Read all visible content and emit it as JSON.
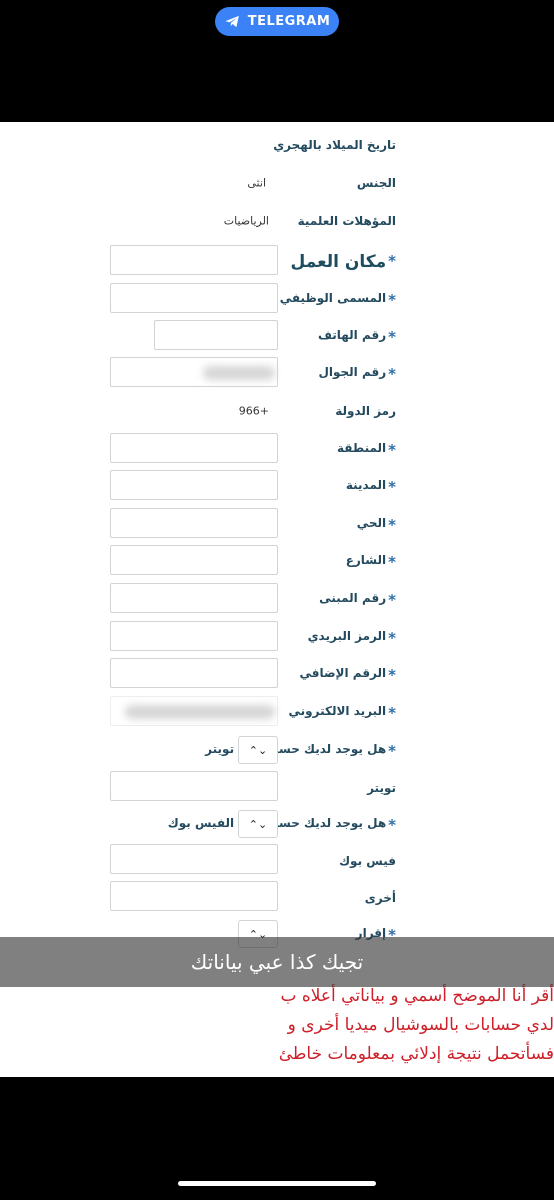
{
  "overlay": {
    "channel_label": "TELEGRAM",
    "caption": "تجيك كذا عبي بياناتك"
  },
  "form": {
    "hijri_birthdate_label": "تاريخ الميلاد بالهجري",
    "gender_label": "الجنس",
    "gender_value": "انثى",
    "qualification_label": "المؤهلات العلمية",
    "qualification_value": "الرياضيات",
    "workplace_label": "مكان العمل",
    "job_title_label": "المسمى الوظيفي",
    "phone_label": "رقم الهاتف",
    "mobile_label": "رقم الجوال",
    "country_code_label": "رمز الدولة",
    "country_code_value": "966+",
    "region_label": "المنطقة",
    "city_label": "المدينة",
    "district_label": "الحي",
    "street_label": "الشارع",
    "building_no_label": "رقم المبنى",
    "postal_code_label": "الرمز البريدي",
    "additional_no_label": "الرقم الإضافي",
    "email_label": "البريد الالكتروني",
    "has_twitter_label": "هل يوجد لديك حساب في تويتر",
    "twitter_label": "تويتر",
    "has_facebook_label": "هل يوجد لديك حساب في الفيس بوك",
    "facebook_label": "فيس بوك",
    "other_label": "أخرى",
    "declaration_label": "إقرار",
    "select_glyph": "⌃⌄",
    "required_mark": "*"
  },
  "declaration_text": {
    "line1": "أقر أنا الموضح أسمي و بياناتي أعلاه ب",
    "line2": "لدي حسابات بالسوشيال ميديا أخرى و",
    "line3": "فسأتحمل نتيجة إدلائي بمعلومات خاطئ"
  },
  "colors": {
    "accent_telegram": "#3a82f6",
    "label": "#234a5e",
    "required": "#2f6fa8",
    "declaration": "#cf1f28"
  }
}
